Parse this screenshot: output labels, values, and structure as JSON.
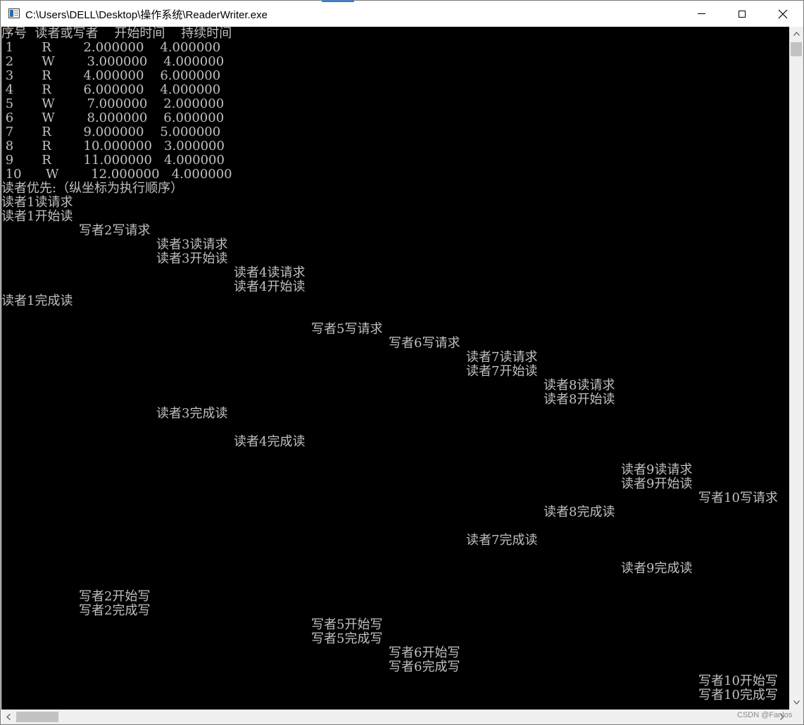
{
  "window": {
    "title": "C:\\Users\\DELL\\Desktop\\操作系统\\ReaderWriter.exe"
  },
  "console": {
    "table_header": "序号  读者或写者    开始时间    持续时间",
    "table_rows": [
      " 1       R        2.000000    4.000000",
      " 2       W        3.000000    4.000000",
      " 3       R        4.000000    6.000000",
      " 4       R        6.000000    4.000000",
      " 5       W        7.000000    2.000000",
      " 6       W        8.000000    6.000000",
      " 7       R        9.000000    5.000000",
      " 8       R        10.000000   3.000000",
      " 9       R        11.000000   4.000000",
      " 10      W        12.000000   4.000000"
    ],
    "section_title": "读者优先:（纵坐标为执行顺序）",
    "events": [
      {
        "column": 0,
        "text": "读者1读请求"
      },
      {
        "column": 0,
        "text": "读者1开始读"
      },
      {
        "column": 1,
        "text": "写者2写请求"
      },
      {
        "column": 2,
        "text": "读者3读请求"
      },
      {
        "column": 2,
        "text": "读者3开始读"
      },
      {
        "column": 3,
        "text": "读者4读请求"
      },
      {
        "column": 3,
        "text": "读者4开始读"
      },
      {
        "column": 0,
        "text": "读者1完成读"
      },
      {
        "column": -1,
        "text": ""
      },
      {
        "column": 4,
        "text": "写者5写请求"
      },
      {
        "column": 5,
        "text": "写者6写请求"
      },
      {
        "column": 6,
        "text": "读者7读请求"
      },
      {
        "column": 6,
        "text": "读者7开始读"
      },
      {
        "column": 7,
        "text": "读者8读请求"
      },
      {
        "column": 7,
        "text": "读者8开始读"
      },
      {
        "column": 2,
        "text": "读者3完成读"
      },
      {
        "column": -1,
        "text": ""
      },
      {
        "column": 3,
        "text": "读者4完成读"
      },
      {
        "column": -1,
        "text": ""
      },
      {
        "column": 8,
        "text": "读者9读请求"
      },
      {
        "column": 8,
        "text": "读者9开始读"
      },
      {
        "column": 9,
        "text": "写者10写请求"
      },
      {
        "column": 7,
        "text": "读者8完成读"
      },
      {
        "column": -1,
        "text": ""
      },
      {
        "column": 6,
        "text": "读者7完成读"
      },
      {
        "column": -1,
        "text": ""
      },
      {
        "column": 8,
        "text": "读者9完成读"
      },
      {
        "column": -1,
        "text": ""
      },
      {
        "column": 1,
        "text": "写者2开始写"
      },
      {
        "column": 1,
        "text": "写者2完成写"
      },
      {
        "column": 4,
        "text": "写者5开始写"
      },
      {
        "column": 4,
        "text": "写者5完成写"
      },
      {
        "column": 5,
        "text": "写者6开始写"
      },
      {
        "column": 5,
        "text": "写者6完成写"
      },
      {
        "column": 9,
        "text": "写者10开始写"
      },
      {
        "column": 9,
        "text": "写者10完成写"
      }
    ]
  },
  "watermark": "CSDN @Fanlos",
  "icons": {
    "app": "console-app-icon",
    "minimize": "minimize-icon",
    "maximize": "maximize-icon",
    "close": "close-icon",
    "scroll_up": "scroll-up-arrow-icon",
    "scroll_down": "scroll-down-arrow-icon",
    "scroll_left": "scroll-left-arrow-icon",
    "scroll_right": "scroll-right-arrow-icon"
  },
  "colors": {
    "console_background": "#000000",
    "console_text": "#c0c0c0",
    "titlebar_background": "#ffffff"
  }
}
